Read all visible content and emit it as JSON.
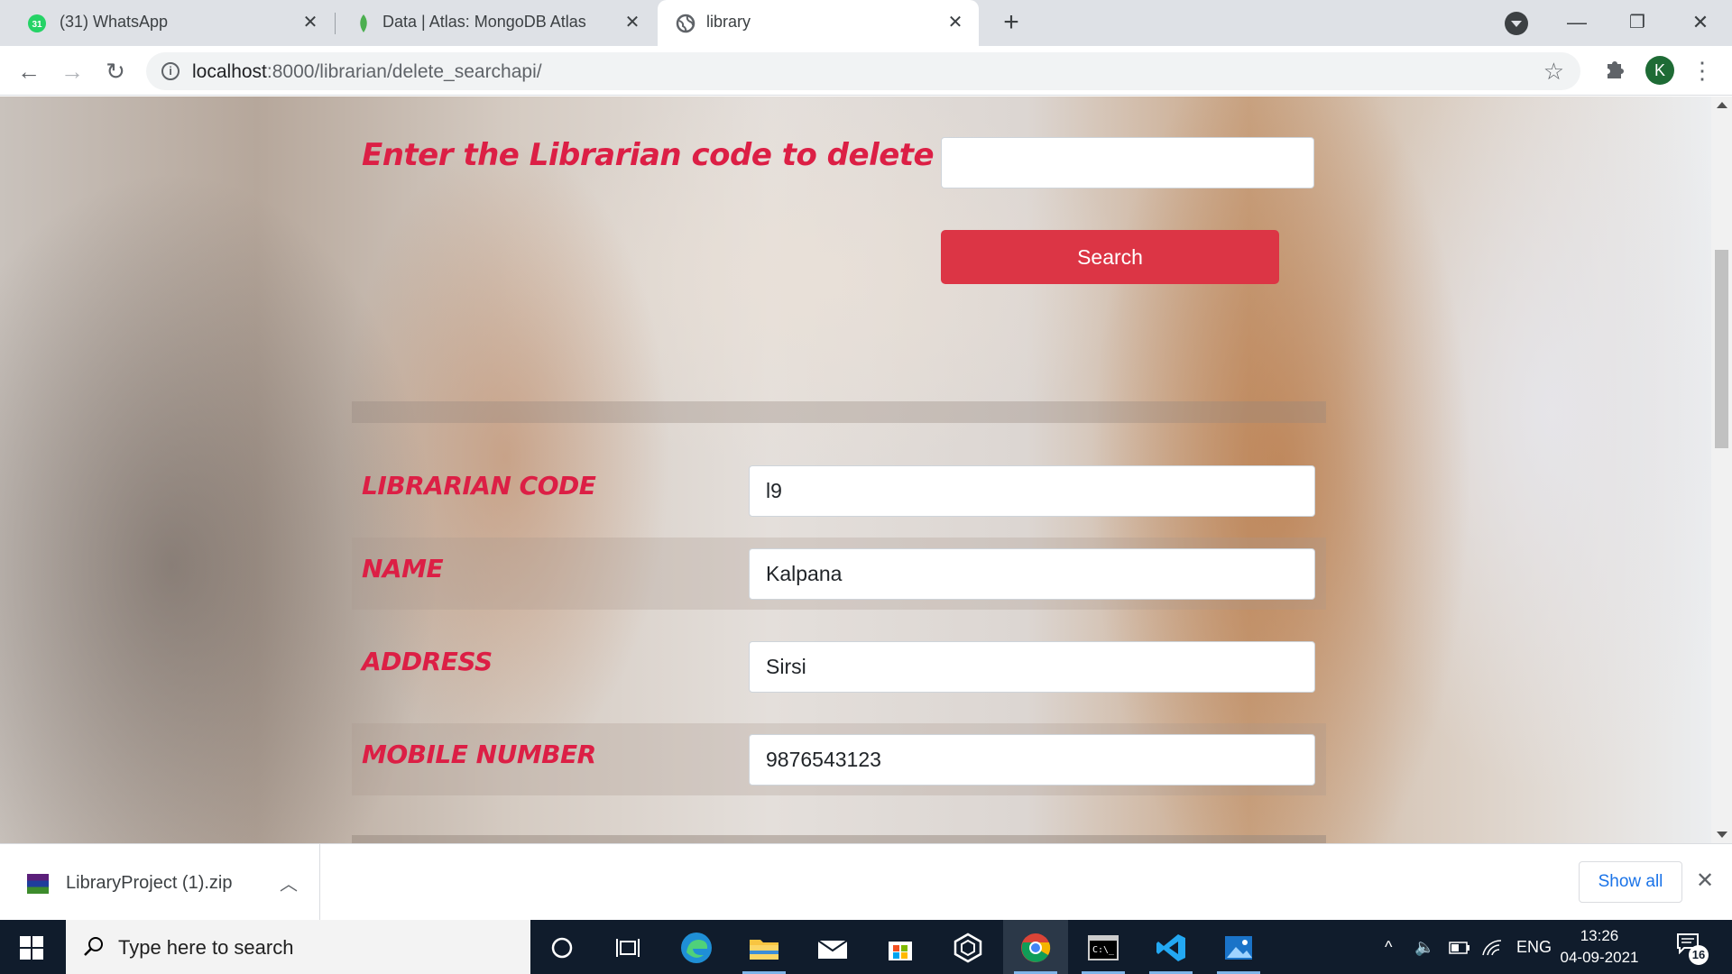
{
  "browser": {
    "tabs": [
      {
        "title": "(31) WhatsApp",
        "icon": "whatsapp-icon",
        "badge": "31"
      },
      {
        "title": "Data | Atlas: MongoDB Atlas",
        "icon": "mongodb-leaf-icon"
      },
      {
        "title": "library",
        "icon": "globe-icon"
      }
    ],
    "url_host": "localhost",
    "url_path": ":8000/librarian/delete_searchapi/",
    "profile_initial": "K"
  },
  "page": {
    "heading": "Enter the Librarian code to delete",
    "code_input_value": "",
    "search_label": "Search",
    "fields": [
      {
        "label": "LIBRARIAN CODE",
        "value": "l9"
      },
      {
        "label": "NAME",
        "value": "Kalpana"
      },
      {
        "label": "ADDRESS",
        "value": "Sirsi"
      },
      {
        "label": "MOBILE NUMBER",
        "value": "9876543123"
      }
    ],
    "accent_color": "#dc1f45",
    "button_color": "#dc3545"
  },
  "downloads": {
    "file_name": "LibraryProject (1).zip",
    "show_all_label": "Show all"
  },
  "taskbar": {
    "search_placeholder": "Type here to search",
    "language": "ENG",
    "time": "13:26",
    "date": "04-09-2021",
    "notification_count": "16"
  }
}
